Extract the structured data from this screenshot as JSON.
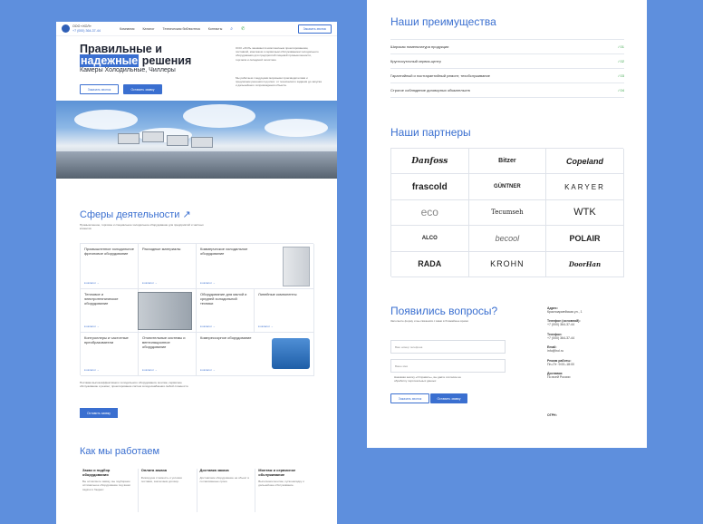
{
  "header": {
    "company": "ООО «ХОЛ»",
    "phone": "+7 (000) 364-37-44",
    "nav": [
      "Компания",
      "Каталог",
      "Техническая библиотека",
      "Контакты"
    ],
    "cta": "Заказать звонок"
  },
  "hero": {
    "title_line1": "Правильные и",
    "title_highlight": "надежные",
    "title_line2_rest": "решения",
    "subtitle": "Камеры Холодильные, Чиллеры",
    "para1": "ООО «ХОЛ» занимается комплексным проектированием, поставкой, монтажом и сервисным обслуживанием холодильного оборудования для предприятий пищевой промышленности, торговли и складской логистики.",
    "para2": "Мы работаем с ведущими мировыми производителями и предлагаем решения под ключ: от технического задания до запуска и дальнейшего сопровождения объекта.",
    "btn_secondary": "Заказать звонок",
    "btn_primary": "Оставить заявку"
  },
  "activities": {
    "title": "Сферы деятельности",
    "arrow": "↗",
    "desc": "Промышленное, торговое и специальное холодильное оборудование для предприятий и частных клиентов",
    "more": "в каталог",
    "items": [
      "Промышленное холодильное фреоновое оборудование",
      "Расходные материалы",
      "Коммерческое холодильное оборудование",
      "Тепловое и электротехническое оборудование",
      "Оборудование для малой и средней холодильной техники",
      "Линейные компоненты",
      "Контроллеры и частотные преобразователи",
      "Отопительные системы и вентиляционное оборудование",
      "Компрессорное оборудование"
    ],
    "note": "Поставка высокоэффективного холодильного оборудования, монтаж, сервисное обслуживание и ремонт, проектирование систем холодоснабжения любой сложности.",
    "btn": "Оставить заявку"
  },
  "how": {
    "title": "Как мы работаем",
    "steps": [
      {
        "title": "Заказ и подбор оборудования",
        "desc": "Вы оставляете заявку, мы подбираем оптимальное оборудование под ваши задачи и бюджет."
      },
      {
        "title": "Оплата заказа",
        "desc": "Фиксируем стоимость и условия поставки, заключаем договор."
      },
      {
        "title": "Доставка заказа",
        "desc": "Доставляем оборудование на объект в согласованные сроки."
      },
      {
        "title": "Монтаж и сервисное обслуживание",
        "desc": "Выполняем монтаж, пусконаладку и дальнейшее обслуживание."
      }
    ]
  },
  "advantages": {
    "title": "Наши преимущества",
    "items": [
      {
        "label": "Широкая номенклатура продукции",
        "num": "/ 01"
      },
      {
        "label": "Круглосуточный сервис-центр",
        "num": "/ 02"
      },
      {
        "label": "Гарантийный и постгарантийный ремонт, техобслуживание",
        "num": "/ 03"
      },
      {
        "label": "Строгое соблюдение договорных обязательств",
        "num": "/ 04"
      }
    ]
  },
  "partners": {
    "title": "Наши партнеры",
    "logos": [
      "Danfoss",
      "Bitzer",
      "Copeland",
      "frascold",
      "GÜNTNER",
      "KARYER",
      "eco",
      "Tecumseh",
      "WTK",
      "ALCO",
      "becool",
      "POLAIR",
      "RADA",
      "KROHN",
      "DoorHan"
    ]
  },
  "contact": {
    "title": "Появились вопросы?",
    "desc": "Заполните форму и мы свяжемся с вами в ближайшее время",
    "phone_placeholder": "Ваш номер телефона",
    "name_placeholder": "Ваше имя",
    "consent": "Нажимая кнопку «Отправить», вы даёте согласие на обработку персональных данных",
    "btn_secondary": "Заказать звонок",
    "btn_primary": "Оставить заявку",
    "address_label": "Адрес:",
    "address": "Красноармейская ул., 1",
    "phone_label": "Телефон (основной):",
    "phone": "+7 (000) 364-37-44",
    "phone2_label": "Телефон:",
    "phone2": "+7 (000) 364-37-44",
    "email_label": "Email:",
    "email": "info@hol.ru",
    "hours_label": "Режим работы:",
    "hours": "Пн–Пт: 9:00–18:00",
    "delivery_label": "Доставка:",
    "delivery": "По всей России",
    "ogrn_label": "ОГРН:"
  }
}
